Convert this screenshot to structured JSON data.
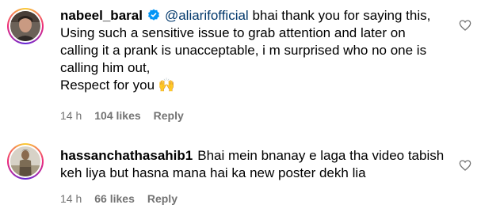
{
  "comments": [
    {
      "username": "nabeel_baral",
      "verified": true,
      "mention": "@aliarifofficial",
      "text": " bhai thank you for saying this,\nUsing such a sensitive issue to grab attention and later on\ncalling it a prank is unacceptable, i m surprised who no one is\ncalling him out,\nRespect for you ",
      "emoji": "🙌",
      "time": "14 h",
      "likes": "104 likes",
      "reply": "Reply",
      "avatar_icon": "person-avatar-icon"
    },
    {
      "username": "hassanchathasahib1",
      "verified": false,
      "text": "Bhai mein bnanay e laga tha video tabish\nkeh liya but hasna mana hai ka new poster dekh lia",
      "time": "14 h",
      "likes": "66 likes",
      "reply": "Reply",
      "avatar_icon": "person-avatar-icon"
    }
  ],
  "colors": {
    "text": "#000000",
    "mention": "#00376b",
    "meta": "#737373",
    "verified": "#0095f6"
  }
}
